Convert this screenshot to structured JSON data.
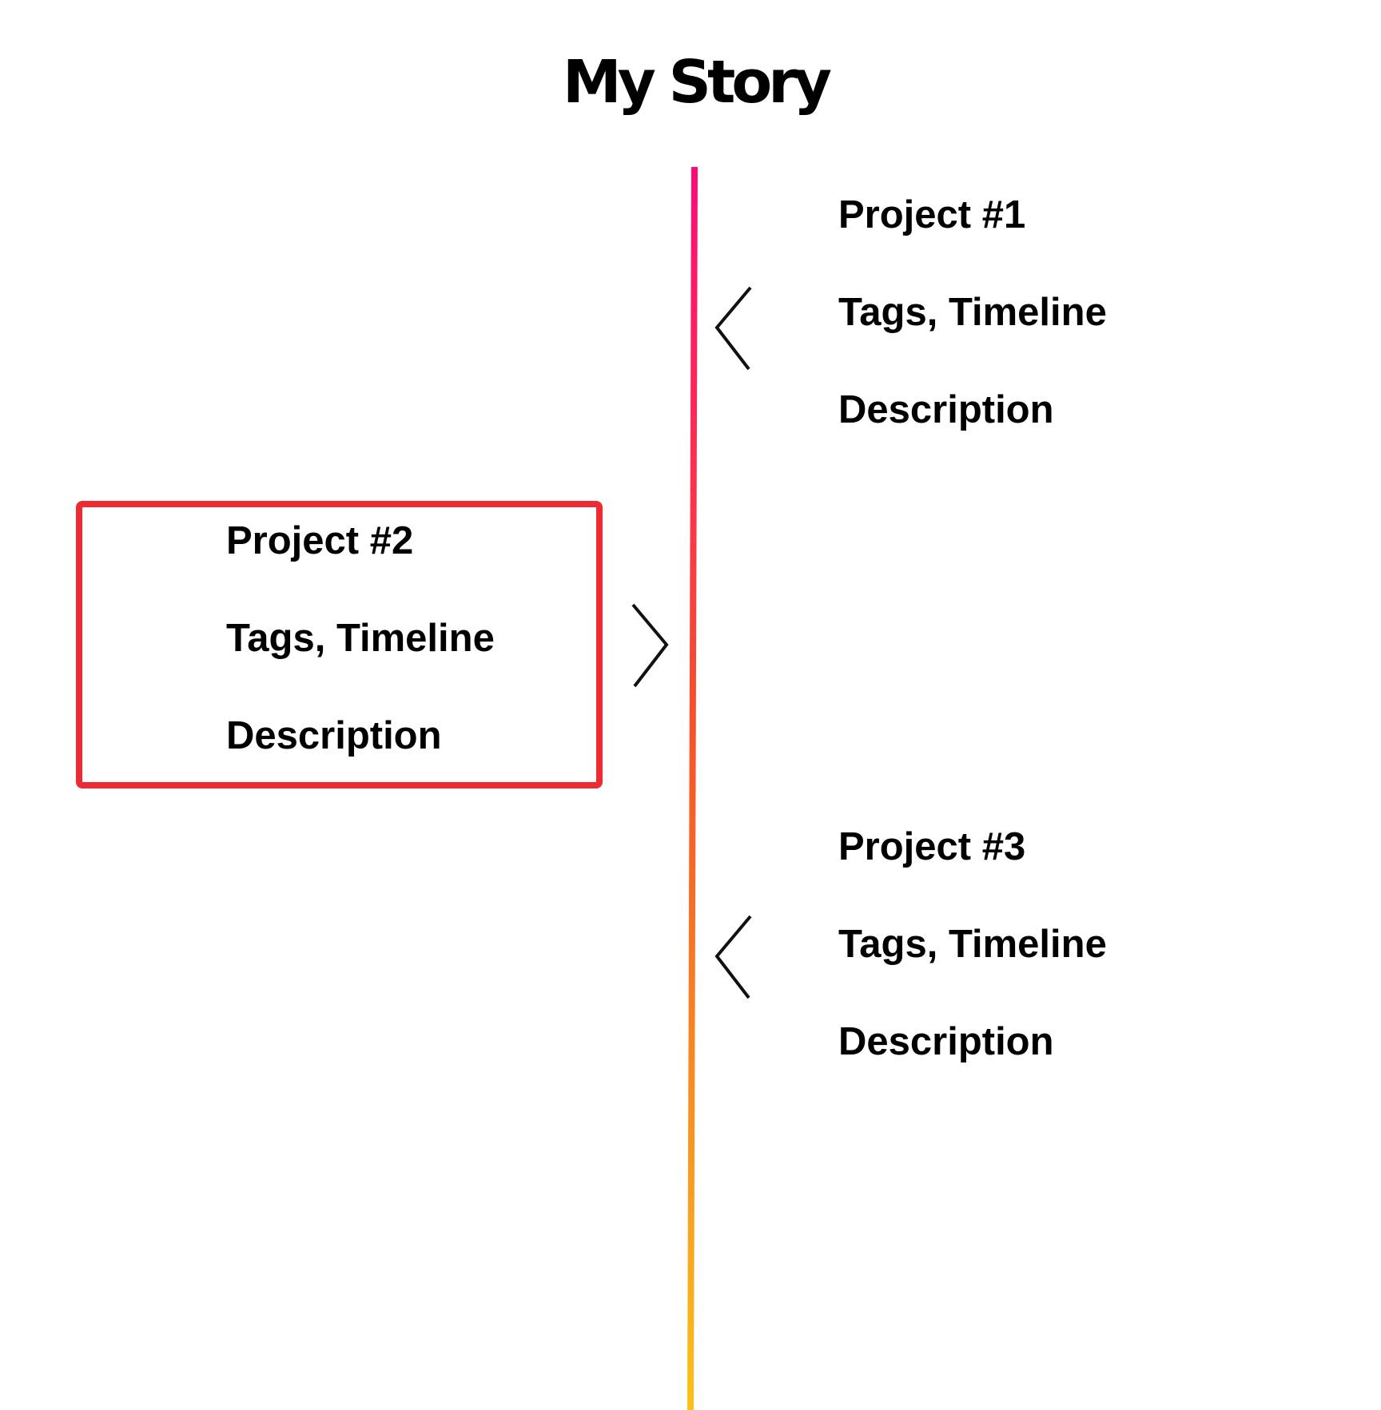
{
  "page": {
    "title": "My Story",
    "line_gradient": {
      "top": "#ff0a78",
      "middle": "#f7512a",
      "bottom": "#f8c21a"
    },
    "highlight_color": "#ee2b32"
  },
  "projects": [
    {
      "title": "Project #1",
      "meta": "Tags, Timeline",
      "description": "Description",
      "side": "right",
      "arrow": "chevron-left-icon"
    },
    {
      "title": "Project #2",
      "meta": "Tags, Timeline",
      "description": "Description",
      "side": "left",
      "arrow": "chevron-right-icon",
      "selected": true
    },
    {
      "title": "Project #3",
      "meta": "Tags, Timeline",
      "description": "Description",
      "side": "right",
      "arrow": "chevron-left-icon"
    }
  ]
}
